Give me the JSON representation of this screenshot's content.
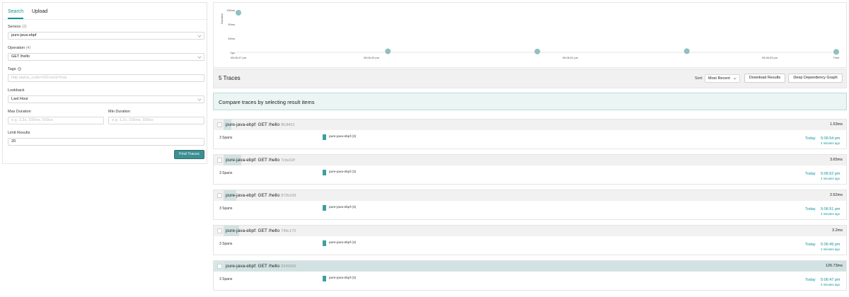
{
  "search_panel": {
    "tabs": [
      "Search",
      "Upload"
    ],
    "service": {
      "label": "Service",
      "count": "(2)",
      "value": "pure-java-ebpf"
    },
    "operation": {
      "label": "Operation",
      "count": "(4)",
      "value": "GET /hello"
    },
    "tags": {
      "label": "Tags",
      "placeholder": "http.status_code=200 error=true"
    },
    "lookback": {
      "label": "Lookback",
      "value": "Last Hour"
    },
    "max_duration": {
      "label": "Max Duration",
      "placeholder": "e.g. 1.2s, 100ms, 500us"
    },
    "min_duration": {
      "label": "Min Duration",
      "placeholder": "e.g. 1.2s, 100ms, 500us"
    },
    "limit": {
      "label": "Limit Results",
      "value": "20"
    },
    "find_button": "Find Traces"
  },
  "scatter_chart": {
    "y_axis_label": "Duration",
    "x_axis_label": "Time",
    "y_ticks": [
      "126ms",
      "90ms",
      "45ms",
      "0µs"
    ],
    "x_ticks": [
      "05:06:47 pm",
      "05:06:49 pm",
      "05:06:51 pm",
      "05:06:53 pm"
    ],
    "point_color": "#92bfc1"
  },
  "chart_data": {
    "type": "scatter",
    "x": [
      "05:06:47 pm",
      "05:06:49 pm",
      "05:06:51 pm",
      "05:06:52 pm",
      "05:06:54 pm"
    ],
    "values": [
      126.73,
      3.2,
      2.62,
      3.65,
      1.53
    ],
    "y_unit": "ms",
    "ylim": [
      0,
      126
    ],
    "xlabel": "Time",
    "ylabel": "Duration"
  },
  "results": {
    "count_title": "5 Traces",
    "sort_label": "Sort:",
    "sort_value": "Most Recent",
    "download_button": "Download Results",
    "dependency_button": "Deep Dependency Graph",
    "compare_banner": "Compare traces by selecting result items",
    "traces": [
      {
        "title": "pure-java-ebpf: GET /hello",
        "id": "8fc8401",
        "duration": "1.53ms",
        "duration_ms": 1.53,
        "spans": "3 Spans",
        "service": "pure-java-ebpf (3)",
        "day": "Today",
        "time": "5:06:54 pm",
        "ago": "2 minutes ago"
      },
      {
        "title": "pure-java-ebpf: GET /hello",
        "id": "7cbe32f",
        "duration": "3.65ms",
        "duration_ms": 3.65,
        "spans": "3 Spans",
        "service": "pure-java-ebpf (3)",
        "day": "Today",
        "time": "5:06:52 pm",
        "ago": "2 minutes ago"
      },
      {
        "title": "pure-java-ebpf: GET /hello",
        "id": "872b199",
        "duration": "2.62ms",
        "duration_ms": 2.62,
        "spans": "3 Spans",
        "service": "pure-java-ebpf (3)",
        "day": "Today",
        "time": "5:06:51 pm",
        "ago": "2 minutes ago"
      },
      {
        "title": "pure-java-ebpf: GET /hello",
        "id": "749c173",
        "duration": "3.2ms",
        "duration_ms": 3.2,
        "spans": "3 Spans",
        "service": "pure-java-ebpf (3)",
        "day": "Today",
        "time": "5:06:49 pm",
        "ago": "2 minutes ago"
      },
      {
        "title": "pure-java-ebpf: GET /hello",
        "id": "8349966",
        "duration": "126.73ms",
        "duration_ms": 126.73,
        "spans": "3 Spans",
        "service": "pure-java-ebpf (3)",
        "day": "Today",
        "time": "5:06:47 pm",
        "ago": "2 minutes ago"
      }
    ]
  }
}
